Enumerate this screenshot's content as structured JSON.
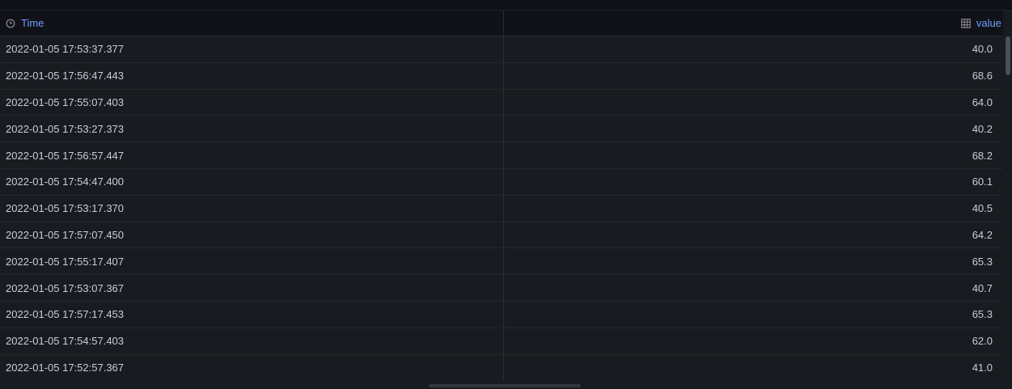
{
  "table": {
    "headers": {
      "time": "Time",
      "value": "value",
      "time_icon": "clock-icon",
      "value_icon": "table-icon"
    },
    "rows": [
      {
        "time": "2022-01-05 17:53:37.377",
        "value": "40.0"
      },
      {
        "time": "2022-01-05 17:56:47.443",
        "value": "68.6"
      },
      {
        "time": "2022-01-05 17:55:07.403",
        "value": "64.0"
      },
      {
        "time": "2022-01-05 17:53:27.373",
        "value": "40.2"
      },
      {
        "time": "2022-01-05 17:56:57.447",
        "value": "68.2"
      },
      {
        "time": "2022-01-05 17:54:47.400",
        "value": "60.1"
      },
      {
        "time": "2022-01-05 17:53:17.370",
        "value": "40.5"
      },
      {
        "time": "2022-01-05 17:57:07.450",
        "value": "64.2"
      },
      {
        "time": "2022-01-05 17:55:17.407",
        "value": "65.3"
      },
      {
        "time": "2022-01-05 17:53:07.367",
        "value": "40.7"
      },
      {
        "time": "2022-01-05 17:57:17.453",
        "value": "65.3"
      },
      {
        "time": "2022-01-05 17:54:57.403",
        "value": "62.0"
      },
      {
        "time": "2022-01-05 17:52:57.367",
        "value": "41.0"
      }
    ]
  },
  "colors": {
    "header_text": "#6e9fff",
    "cell_text": "#ccccdc",
    "panel_bg": "#181b1f",
    "page_bg": "#111217"
  }
}
